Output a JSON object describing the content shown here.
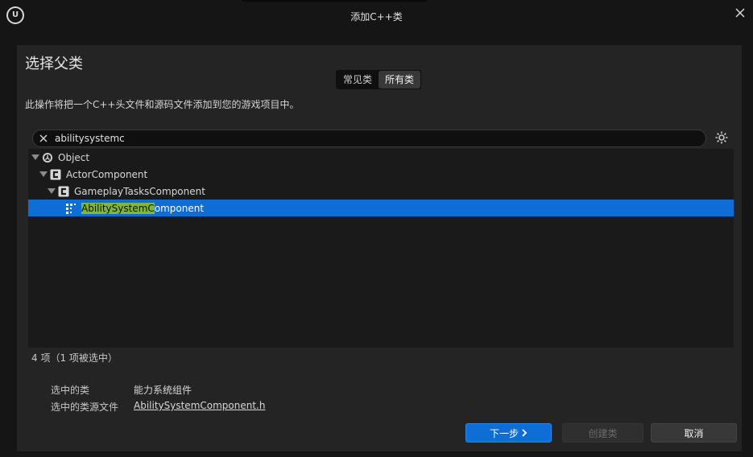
{
  "window": {
    "title": "添加C++类",
    "logo_icon": "unreal-engine-logo",
    "close_icon": "close-icon"
  },
  "dialog": {
    "heading": "选择父类",
    "tabs": [
      {
        "label": "常见类",
        "active": false
      },
      {
        "label": "所有类",
        "active": true
      }
    ],
    "description": "此操作将把一个C++头文件和源码文件添加到您的游戏项目中。"
  },
  "search": {
    "value": "abilitysystemc",
    "clear_icon": "close-icon",
    "settings_icon": "gear-icon"
  },
  "tree": {
    "rows": [
      {
        "label": "Object",
        "icon": "unreal-object-icon",
        "expanded": true,
        "selected": false
      },
      {
        "label": "ActorComponent",
        "icon": "cpp-class-icon",
        "expanded": true,
        "selected": false
      },
      {
        "label": "GameplayTasksComponent",
        "icon": "cpp-class-icon",
        "expanded": true,
        "selected": false
      },
      {
        "label_match": "AbilitySystemC",
        "label_rest": "omponent",
        "icon": "component-dots-icon",
        "expanded": false,
        "selected": true
      }
    ]
  },
  "status": {
    "count_text": "4 项（1 项被选中）"
  },
  "info": {
    "selected_class_label": "选中的类",
    "selected_class_value": "能力系统组件",
    "selected_source_label": "选中的类源文件",
    "selected_source_value": "AbilitySystemComponent.h"
  },
  "buttons": {
    "next": "下一步",
    "create": "创建类",
    "cancel": "取消"
  },
  "colors": {
    "accent": "#0f6ed6",
    "highlight": "#7db83a",
    "background": "#242424"
  }
}
